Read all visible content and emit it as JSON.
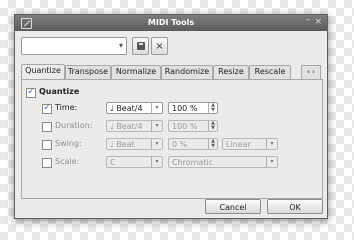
{
  "window": {
    "title": "MIDI Tools",
    "minimize": "–",
    "close": "×"
  },
  "toolbar": {
    "preset_value": "",
    "save_icon": "save-icon",
    "delete_icon": "×"
  },
  "tabs": [
    {
      "label": "Quantize",
      "active": true
    },
    {
      "label": "Transpose"
    },
    {
      "label": "Normalize"
    },
    {
      "label": "Randomize"
    },
    {
      "label": "Resize"
    },
    {
      "label": "Rescale"
    },
    {
      "label": "‹ ›"
    }
  ],
  "quantize": {
    "heading": "Quantize",
    "rows": [
      {
        "label": "Time:",
        "checked": true,
        "value": "♩ Beat/4",
        "spin": "100 %"
      },
      {
        "label": "Duration:",
        "checked": false,
        "value": "♩ Beat/4",
        "spin": "100 %"
      },
      {
        "label": "Swing:",
        "checked": false,
        "value": "♩ Beat",
        "spin": "0 %",
        "extra": "Linear"
      },
      {
        "label": "Scale:",
        "checked": false,
        "value": "C",
        "extra": "Chromatic"
      }
    ]
  },
  "buttons": {
    "cancel": "Cancel",
    "ok": "OK"
  }
}
